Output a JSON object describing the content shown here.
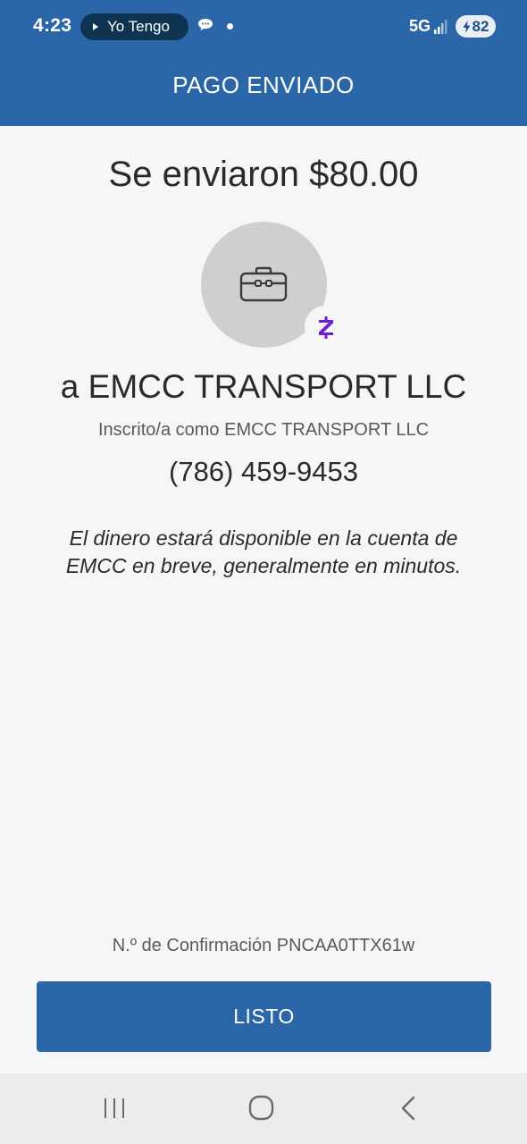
{
  "status_bar": {
    "time": "4:23",
    "media_title": "Yo Tengo",
    "network": "5G",
    "battery_level": "82"
  },
  "header": {
    "title": "PAGO ENVIADO"
  },
  "payment": {
    "amount_line": "Se enviaron $80.00",
    "recipient_line": "a EMCC TRANSPORT LLC",
    "enrolled_as": "Inscrito/a como EMCC TRANSPORT LLC",
    "phone": "(786) 459-9453",
    "notice": "El dinero estará disponible en la cuenta de EMCC en breve, generalmente en minutos.",
    "confirmation": "N.º de Confirmación PNCAA0TTX61w"
  },
  "actions": {
    "done_label": "LISTO"
  },
  "icons": {
    "recipient_avatar": "briefcase-icon",
    "payment_network": "zelle-icon"
  },
  "colors": {
    "brand_blue": "#2b67a8",
    "zelle_purple": "#6d1ed4",
    "avatar_gray": "#cfcfcf"
  }
}
